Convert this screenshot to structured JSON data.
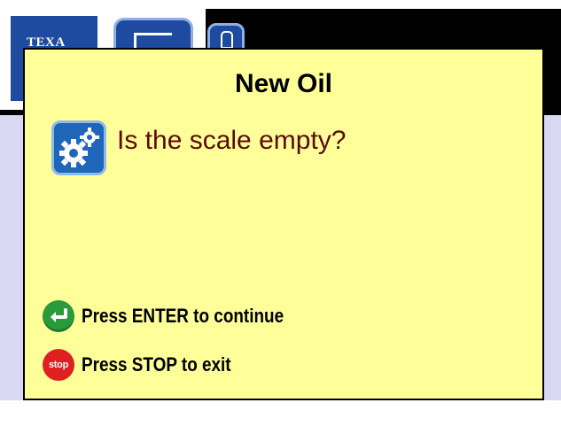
{
  "header": {
    "logo_text": "TEXA",
    "tab_icon": "menu-tab-icon",
    "small_button_icon": "lock-icon"
  },
  "dialog": {
    "title": "New Oil",
    "icon": "gears-icon",
    "question": "Is the scale empty?",
    "question_color": "#5a0a0a",
    "background_color": "#ffff99"
  },
  "actions": {
    "enter": {
      "icon": "enter-icon",
      "label": "Press ENTER to continue",
      "color": "#2a9a3a"
    },
    "stop": {
      "icon": "stop-icon",
      "icon_text": "stop",
      "label": "Press STOP to exit",
      "color": "#e02020"
    }
  }
}
